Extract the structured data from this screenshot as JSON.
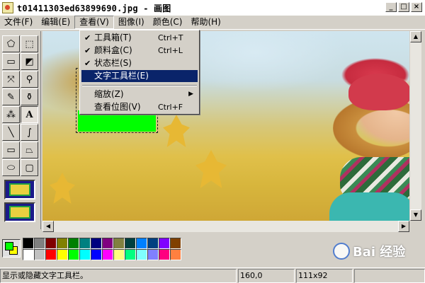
{
  "window": {
    "title": "t01411303ed63899690.jpg - 画图",
    "buttons": {
      "minimize": "_",
      "maximize": "□",
      "close": "×"
    }
  },
  "menu": {
    "items": [
      {
        "label": "文件(F)"
      },
      {
        "label": "编辑(E)"
      },
      {
        "label": "查看(V)",
        "open": true
      },
      {
        "label": "图像(I)"
      },
      {
        "label": "颜色(C)"
      },
      {
        "label": "帮助(H)"
      }
    ]
  },
  "view_menu": {
    "items": [
      {
        "label": "工具箱(T)",
        "shortcut": "Ctrl+T",
        "checked": true
      },
      {
        "label": "颜料盒(C)",
        "shortcut": "Ctrl+L",
        "checked": true
      },
      {
        "label": "状态栏(S)",
        "shortcut": "",
        "checked": true
      },
      {
        "label": "文字工具栏(E)",
        "shortcut": "",
        "checked": false,
        "highlighted": true
      },
      {
        "label": "缩放(Z)",
        "shortcut": "",
        "submenu": true
      },
      {
        "label": "查看位图(V)",
        "shortcut": "Ctrl+F"
      }
    ],
    "check_glyph": "✔",
    "submenu_glyph": "▶"
  },
  "tools": [
    {
      "name": "free-select",
      "glyph": "⬠"
    },
    {
      "name": "rect-select",
      "glyph": "⬚"
    },
    {
      "name": "eraser",
      "glyph": "▭"
    },
    {
      "name": "fill",
      "glyph": "◩"
    },
    {
      "name": "color-picker",
      "glyph": "⤧"
    },
    {
      "name": "magnifier",
      "glyph": "⚲"
    },
    {
      "name": "pencil",
      "glyph": "✎"
    },
    {
      "name": "brush",
      "glyph": "⚱"
    },
    {
      "name": "airbrush",
      "glyph": "⁂"
    },
    {
      "name": "text",
      "glyph": "A"
    },
    {
      "name": "line",
      "glyph": "╲"
    },
    {
      "name": "curve",
      "glyph": "∫"
    },
    {
      "name": "rectangle",
      "glyph": "▭"
    },
    {
      "name": "polygon",
      "glyph": "⏢"
    },
    {
      "name": "ellipse",
      "glyph": "⬭"
    },
    {
      "name": "rounded-rect",
      "glyph": "▢"
    }
  ],
  "palette": {
    "foreground": "#00ff00",
    "background": "#ffff00",
    "row1": [
      "#000000",
      "#808080",
      "#800000",
      "#808000",
      "#008000",
      "#008080",
      "#000080",
      "#800080",
      "#808040",
      "#004040",
      "#0080ff",
      "#004080",
      "#8000ff",
      "#804000"
    ],
    "row2": [
      "#ffffff",
      "#c0c0c0",
      "#ff0000",
      "#ffff00",
      "#00ff00",
      "#00ffff",
      "#0000ff",
      "#ff00ff",
      "#ffff80",
      "#00ff80",
      "#80ffff",
      "#8080ff",
      "#ff0080",
      "#ff8040"
    ]
  },
  "status": {
    "help": "显示或隐藏文字工具栏。",
    "coords": "160,0",
    "size": "111x92"
  },
  "watermark": {
    "text": "Bai 经验"
  }
}
